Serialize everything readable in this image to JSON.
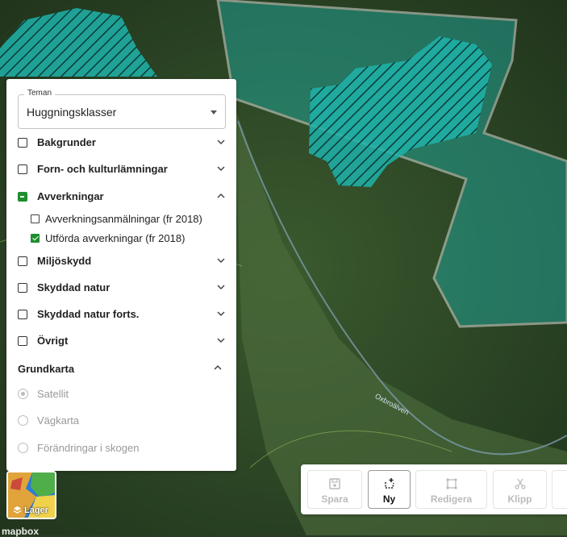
{
  "panel": {
    "theme": {
      "legend": "Teman",
      "value": "Huggningsklasser"
    },
    "layers": [
      {
        "label": "Bakgrunder",
        "state": "unchecked",
        "expanded": false
      },
      {
        "label": "Forn- och kulturlämningar",
        "state": "unchecked",
        "expanded": false
      },
      {
        "label": "Avverkningar",
        "state": "partial",
        "expanded": true,
        "children": [
          {
            "label": "Avverkningsanmälningar (fr 2018)",
            "checked": false
          },
          {
            "label": "Utförda avverkningar (fr 2018)",
            "checked": true
          }
        ]
      },
      {
        "label": "Miljöskydd",
        "state": "unchecked",
        "expanded": false
      },
      {
        "label": "Skyddad natur",
        "state": "unchecked",
        "expanded": false
      },
      {
        "label": "Skyddad natur forts.",
        "state": "unchecked",
        "expanded": false
      },
      {
        "label": "Övrigt",
        "state": "unchecked",
        "expanded": false
      }
    ],
    "basemap": {
      "title": "Grundkarta",
      "options": [
        {
          "label": "Satellit",
          "selected": true
        },
        {
          "label": "Vägkarta",
          "selected": false
        },
        {
          "label": "Förändringar i skogen",
          "selected": false
        }
      ]
    }
  },
  "layers_button": {
    "label": "Lager"
  },
  "attribution": "mapbox",
  "river_label": "Oxbroälven",
  "toolbar": {
    "tools": [
      {
        "label": "Spara",
        "icon": "save-icon",
        "active": false
      },
      {
        "label": "Ny",
        "icon": "new-shape-icon",
        "active": true
      },
      {
        "label": "Redigera",
        "icon": "edit-shape-icon",
        "active": false
      },
      {
        "label": "Klipp",
        "icon": "scissors-icon",
        "active": false
      }
    ]
  },
  "colors": {
    "accent": "#1e8e2e",
    "polygon_fill": "#1fb3aa",
    "polygon_outline": "#ffffff"
  }
}
